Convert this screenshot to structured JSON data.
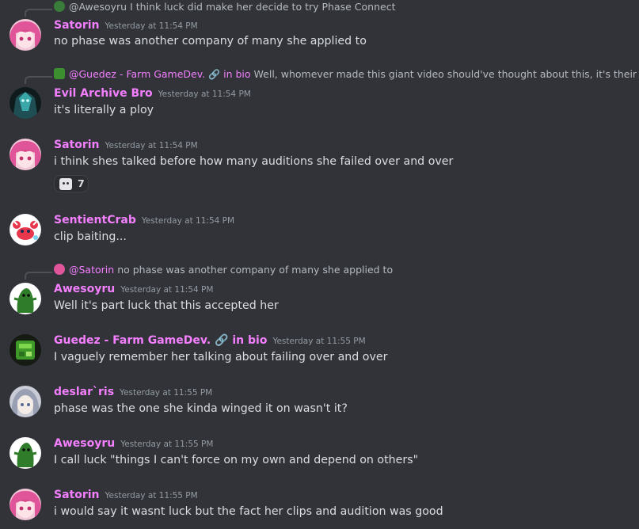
{
  "colors": {
    "background": "#313338",
    "username_pink": "#f47fff",
    "username_green": "#9be089",
    "timestamp": "#949ba4",
    "text": "#dbdee1",
    "reply_text": "#b5bac1"
  },
  "messages": [
    {
      "reply": {
        "name": "@Awesoyru",
        "text": "I think luck did make her decide to try Phase Connect",
        "avatar": "green-lizard"
      },
      "author": "Satorin",
      "author_color": "#f47fff",
      "timestamp": "Yesterday at 11:54 PM",
      "text": "no phase was another company of many she applied to",
      "avatar": "pink-hair"
    },
    {
      "reply": {
        "name": "@Guedez - Farm GameDev.",
        "bio_icon": "link-icon",
        "bio_suffix": "in bio",
        "text": "Well, whomever made this giant video should've thought about this, it's their fault",
        "avatar": "green-box"
      },
      "author": "Evil Archive Bro",
      "author_color": "#f47fff",
      "timestamp": "Yesterday at 11:54 PM",
      "text": "it's literally a ploy",
      "avatar": "dark-teal"
    },
    {
      "author": "Satorin",
      "author_color": "#f47fff",
      "timestamp": "Yesterday at 11:54 PM",
      "text": "i think shes talked before how many auditions she failed over and over",
      "avatar": "pink-hair",
      "reaction": {
        "emoji": "face-emoji",
        "count": "7"
      }
    },
    {
      "author": "SentientCrab",
      "author_color": "#f47fff",
      "timestamp": "Yesterday at 11:54 PM",
      "text": "clip baiting...",
      "avatar": "crab"
    },
    {
      "reply": {
        "name": "@Satorin",
        "text": "no phase was another company of many she applied to",
        "avatar": "pink-hair"
      },
      "author": "Awesoyru",
      "author_color": "#f47fff",
      "timestamp": "Yesterday at 11:54 PM",
      "text": "Well it's part luck that this accepted her",
      "avatar": "green-lizard"
    },
    {
      "author": "Guedez - Farm GameDev.",
      "author_color": "#f47fff",
      "bio_icon": "link-icon",
      "bio_suffix": "in bio",
      "timestamp": "Yesterday at 11:55 PM",
      "text": "I vaguely remember her talking about failing over and over",
      "avatar": "green-box"
    },
    {
      "author": "deslar`ris",
      "author_color": "#f47fff",
      "timestamp": "Yesterday at 11:55 PM",
      "text": "phase was the one she kinda winged it on wasn't it?",
      "avatar": "silver-hair"
    },
    {
      "author": "Awesoyru",
      "author_color": "#f47fff",
      "timestamp": "Yesterday at 11:55 PM",
      "text": "I call luck \"things I can't force on my own and depend on others\"",
      "avatar": "green-lizard"
    },
    {
      "author": "Satorin",
      "author_color": "#f47fff",
      "timestamp": "Yesterday at 11:55 PM",
      "text": "i would say it wasnt luck but the fact her clips and audition was good",
      "avatar": "pink-hair"
    }
  ]
}
